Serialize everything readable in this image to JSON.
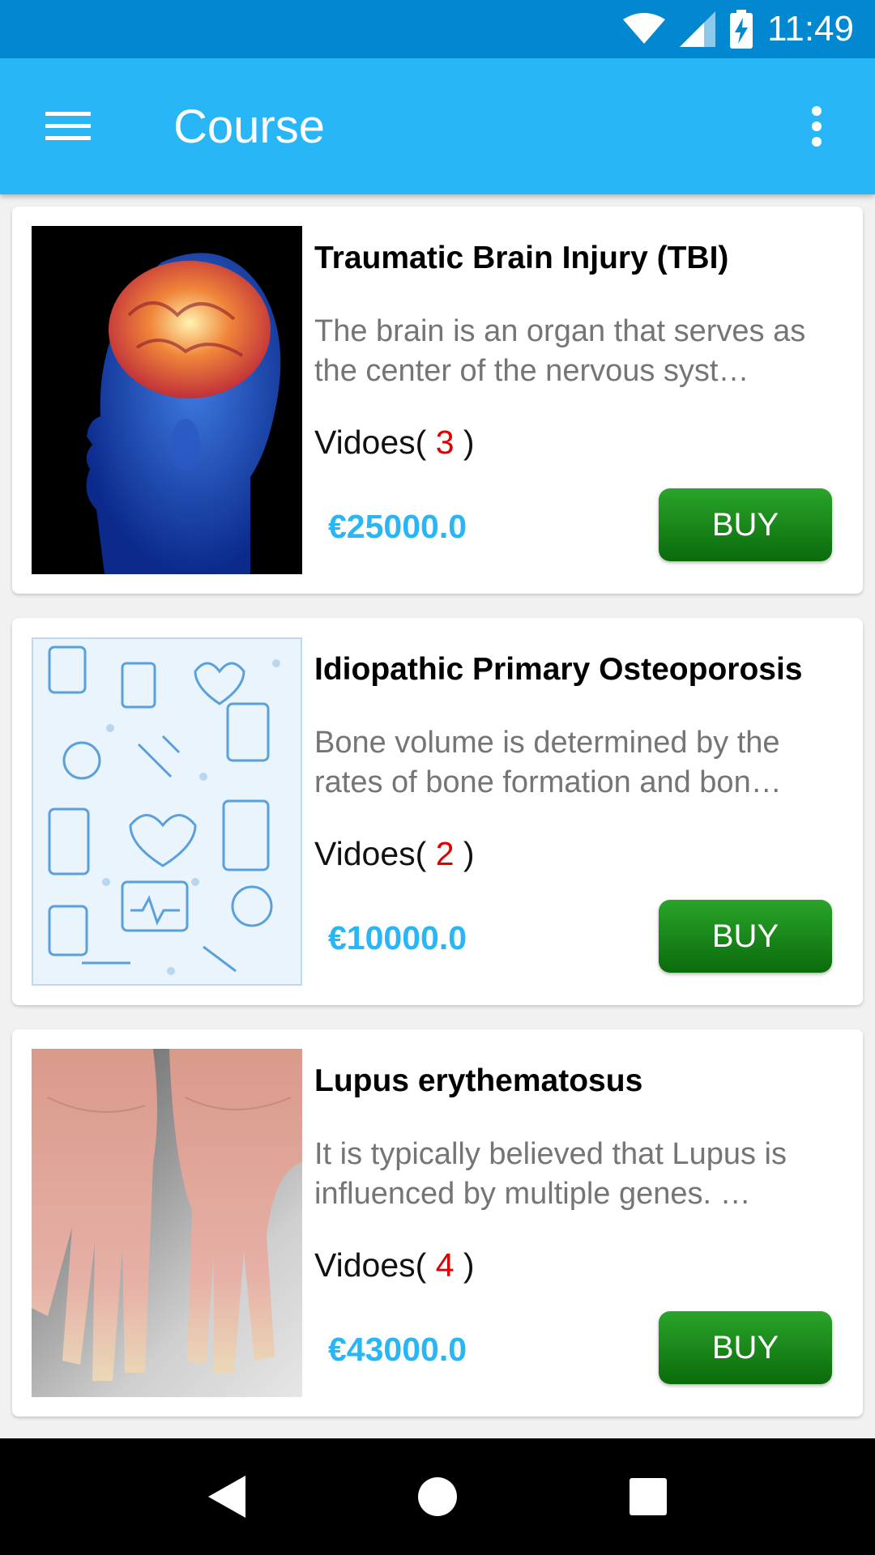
{
  "status_bar": {
    "time": "11:49"
  },
  "app_bar": {
    "title": "Course"
  },
  "courses": [
    {
      "title": "Traumatic Brain Injury (TBI)",
      "description": "The brain is an organ that serves as the center of the nervous syst…",
      "videos_label": "Vidoes(",
      "videos_count": "3",
      "videos_close": ")",
      "price": "€25000.0",
      "buy_label": "BUY",
      "image": "brain-image"
    },
    {
      "title": "Idiopathic Primary Osteoporosis",
      "description": "Bone volume is determined by the rates of bone formation and bon…",
      "videos_label": "Vidoes(",
      "videos_count": "2",
      "videos_close": ")",
      "price": "€10000.0",
      "buy_label": "BUY",
      "image": "medical-pattern-image"
    },
    {
      "title": "Lupus erythematosus",
      "description": "It is typically believed that Lupus is influenced by multiple genes. …",
      "videos_label": "Vidoes(",
      "videos_count": "4",
      "videos_close": ")",
      "price": "€43000.0",
      "buy_label": "BUY",
      "image": "hands-image"
    }
  ],
  "colors": {
    "status_bar": "#0288d1",
    "app_bar": "#29b6f6",
    "price": "#29b6f6",
    "video_count": "#e00000",
    "buy_button": "#0b6b0b"
  }
}
